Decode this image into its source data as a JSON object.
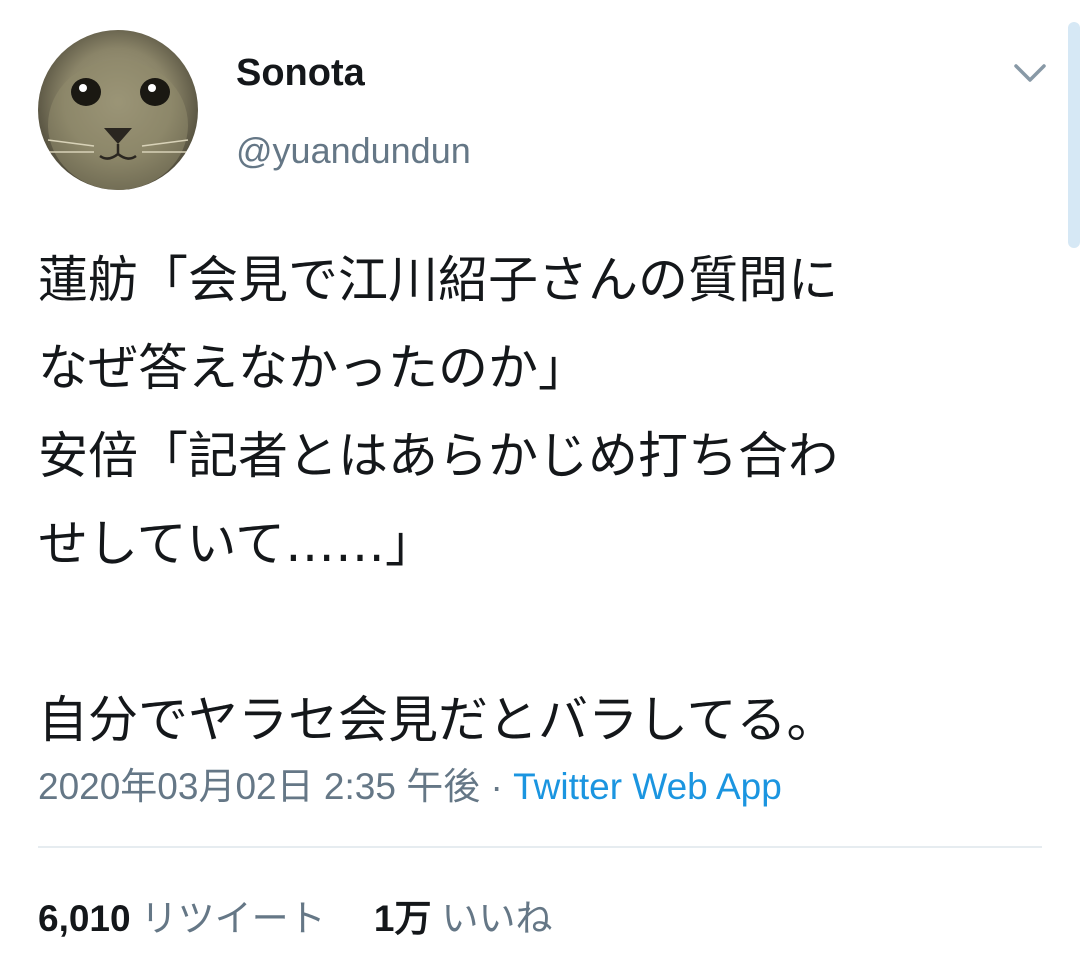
{
  "tweet": {
    "user": {
      "display_name": "Sonota",
      "handle": "@yuandundun"
    },
    "text": "蓮舫「会見で江川紹子さんの質問に\nなぜ答えなかったのか」\n安倍「記者とはあらかじめ打ち合わ\nせしていて……」\n\n自分でヤラセ会見だとバラしてる。",
    "timestamp": "2020年03月02日 2:35 午後",
    "separator": " · ",
    "source": "Twitter Web App",
    "retweets": {
      "count": "6,010",
      "label": "リツイート"
    },
    "likes": {
      "count": "1万",
      "label": "いいね"
    }
  },
  "icons": {
    "menu": "chevron-down-icon"
  },
  "colors": {
    "text": "#14171a",
    "secondary": "#657786",
    "link": "#1b95e0",
    "divider": "#e6ecf0"
  }
}
